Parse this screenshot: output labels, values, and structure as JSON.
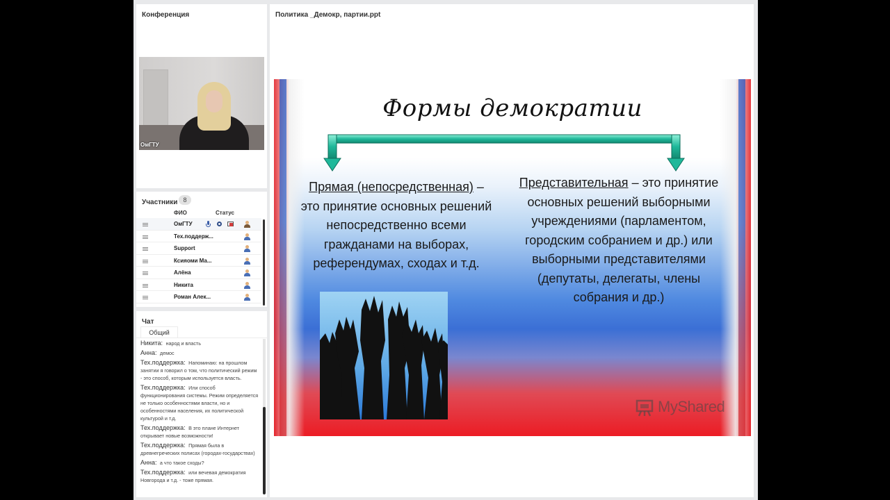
{
  "conference": {
    "title": "Конференция",
    "video_label": "ОмГТУ"
  },
  "participants": {
    "title": "Участники",
    "count": "8",
    "col_name": "ФИО",
    "col_status": "Статус",
    "rows": [
      {
        "name": "ОмГТУ"
      },
      {
        "name": "Тех.поддерж..."
      },
      {
        "name": "Support"
      },
      {
        "name": "Ксияоми Ма..."
      },
      {
        "name": "Алёна"
      },
      {
        "name": "Никита"
      },
      {
        "name": "Роман Алек..."
      }
    ]
  },
  "chat": {
    "title": "Чат",
    "tab": "Общий",
    "messages": [
      {
        "author": "Никита:",
        "text": "народ и власть"
      },
      {
        "author": "Анна:",
        "text": "демос"
      },
      {
        "author": "Тех.поддержка:",
        "text": "Напоминаю: на прошлом занятии я говорил о том, что политический режим - это способ, которым используется власть."
      },
      {
        "author": "Тех.поддержка:",
        "text": "Или способ функционирования системы. Режим определяется не только особенностями власти, но и особенностями населения, их политической культурой и т.д."
      },
      {
        "author": "Тех.поддержка:",
        "text": "В это плане Интернет открывает новые возможности!"
      },
      {
        "author": "Тех.поддержка:",
        "text": "Прямая была в древнегреческих полисах (городах-государствах)"
      },
      {
        "author": "Анна:",
        "text": "а что такое сходы?"
      },
      {
        "author": "Тех.поддержка:",
        "text": "или вечевая демократия Новгорода и т.д. - тоже прямая."
      }
    ]
  },
  "presentation": {
    "title": "Политика _Демокр, партии.ppt",
    "slide": {
      "title": "Формы демократии",
      "left_term": "Прямая (непосредственная)",
      "left_text": "– это принятие основных решений непосредственно всеми гражданами на выборах, референдумах, сходах и т.д.",
      "right_term": "Представительная",
      "right_text": "– это принятие основных решений выборными учреждениями (парламентом, городским собранием и др.) или выборными представителями (депутаты, делегаты, члены собрания и др.)",
      "watermark": "MyShared"
    }
  },
  "colors": {
    "arrow": "#1fb89a",
    "flag_red": "#ec1c24",
    "flag_blue": "#3b6fd5"
  }
}
